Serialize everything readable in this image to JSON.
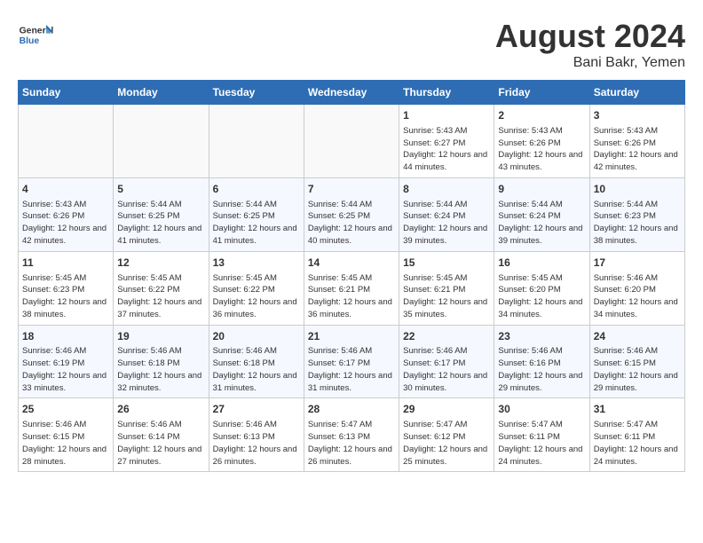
{
  "header": {
    "logo_general": "General",
    "logo_blue": "Blue",
    "title": "August 2024",
    "location": "Bani Bakr, Yemen"
  },
  "weekdays": [
    "Sunday",
    "Monday",
    "Tuesday",
    "Wednesday",
    "Thursday",
    "Friday",
    "Saturday"
  ],
  "weeks": [
    [
      {
        "day": "",
        "sunrise": "",
        "sunset": "",
        "daylight": ""
      },
      {
        "day": "",
        "sunrise": "",
        "sunset": "",
        "daylight": ""
      },
      {
        "day": "",
        "sunrise": "",
        "sunset": "",
        "daylight": ""
      },
      {
        "day": "",
        "sunrise": "",
        "sunset": "",
        "daylight": ""
      },
      {
        "day": "1",
        "sunrise": "Sunrise: 5:43 AM",
        "sunset": "Sunset: 6:27 PM",
        "daylight": "Daylight: 12 hours and 44 minutes."
      },
      {
        "day": "2",
        "sunrise": "Sunrise: 5:43 AM",
        "sunset": "Sunset: 6:26 PM",
        "daylight": "Daylight: 12 hours and 43 minutes."
      },
      {
        "day": "3",
        "sunrise": "Sunrise: 5:43 AM",
        "sunset": "Sunset: 6:26 PM",
        "daylight": "Daylight: 12 hours and 42 minutes."
      }
    ],
    [
      {
        "day": "4",
        "sunrise": "Sunrise: 5:43 AM",
        "sunset": "Sunset: 6:26 PM",
        "daylight": "Daylight: 12 hours and 42 minutes."
      },
      {
        "day": "5",
        "sunrise": "Sunrise: 5:44 AM",
        "sunset": "Sunset: 6:25 PM",
        "daylight": "Daylight: 12 hours and 41 minutes."
      },
      {
        "day": "6",
        "sunrise": "Sunrise: 5:44 AM",
        "sunset": "Sunset: 6:25 PM",
        "daylight": "Daylight: 12 hours and 41 minutes."
      },
      {
        "day": "7",
        "sunrise": "Sunrise: 5:44 AM",
        "sunset": "Sunset: 6:25 PM",
        "daylight": "Daylight: 12 hours and 40 minutes."
      },
      {
        "day": "8",
        "sunrise": "Sunrise: 5:44 AM",
        "sunset": "Sunset: 6:24 PM",
        "daylight": "Daylight: 12 hours and 39 minutes."
      },
      {
        "day": "9",
        "sunrise": "Sunrise: 5:44 AM",
        "sunset": "Sunset: 6:24 PM",
        "daylight": "Daylight: 12 hours and 39 minutes."
      },
      {
        "day": "10",
        "sunrise": "Sunrise: 5:44 AM",
        "sunset": "Sunset: 6:23 PM",
        "daylight": "Daylight: 12 hours and 38 minutes."
      }
    ],
    [
      {
        "day": "11",
        "sunrise": "Sunrise: 5:45 AM",
        "sunset": "Sunset: 6:23 PM",
        "daylight": "Daylight: 12 hours and 38 minutes."
      },
      {
        "day": "12",
        "sunrise": "Sunrise: 5:45 AM",
        "sunset": "Sunset: 6:22 PM",
        "daylight": "Daylight: 12 hours and 37 minutes."
      },
      {
        "day": "13",
        "sunrise": "Sunrise: 5:45 AM",
        "sunset": "Sunset: 6:22 PM",
        "daylight": "Daylight: 12 hours and 36 minutes."
      },
      {
        "day": "14",
        "sunrise": "Sunrise: 5:45 AM",
        "sunset": "Sunset: 6:21 PM",
        "daylight": "Daylight: 12 hours and 36 minutes."
      },
      {
        "day": "15",
        "sunrise": "Sunrise: 5:45 AM",
        "sunset": "Sunset: 6:21 PM",
        "daylight": "Daylight: 12 hours and 35 minutes."
      },
      {
        "day": "16",
        "sunrise": "Sunrise: 5:45 AM",
        "sunset": "Sunset: 6:20 PM",
        "daylight": "Daylight: 12 hours and 34 minutes."
      },
      {
        "day": "17",
        "sunrise": "Sunrise: 5:46 AM",
        "sunset": "Sunset: 6:20 PM",
        "daylight": "Daylight: 12 hours and 34 minutes."
      }
    ],
    [
      {
        "day": "18",
        "sunrise": "Sunrise: 5:46 AM",
        "sunset": "Sunset: 6:19 PM",
        "daylight": "Daylight: 12 hours and 33 minutes."
      },
      {
        "day": "19",
        "sunrise": "Sunrise: 5:46 AM",
        "sunset": "Sunset: 6:18 PM",
        "daylight": "Daylight: 12 hours and 32 minutes."
      },
      {
        "day": "20",
        "sunrise": "Sunrise: 5:46 AM",
        "sunset": "Sunset: 6:18 PM",
        "daylight": "Daylight: 12 hours and 31 minutes."
      },
      {
        "day": "21",
        "sunrise": "Sunrise: 5:46 AM",
        "sunset": "Sunset: 6:17 PM",
        "daylight": "Daylight: 12 hours and 31 minutes."
      },
      {
        "day": "22",
        "sunrise": "Sunrise: 5:46 AM",
        "sunset": "Sunset: 6:17 PM",
        "daylight": "Daylight: 12 hours and 30 minutes."
      },
      {
        "day": "23",
        "sunrise": "Sunrise: 5:46 AM",
        "sunset": "Sunset: 6:16 PM",
        "daylight": "Daylight: 12 hours and 29 minutes."
      },
      {
        "day": "24",
        "sunrise": "Sunrise: 5:46 AM",
        "sunset": "Sunset: 6:15 PM",
        "daylight": "Daylight: 12 hours and 29 minutes."
      }
    ],
    [
      {
        "day": "25",
        "sunrise": "Sunrise: 5:46 AM",
        "sunset": "Sunset: 6:15 PM",
        "daylight": "Daylight: 12 hours and 28 minutes."
      },
      {
        "day": "26",
        "sunrise": "Sunrise: 5:46 AM",
        "sunset": "Sunset: 6:14 PM",
        "daylight": "Daylight: 12 hours and 27 minutes."
      },
      {
        "day": "27",
        "sunrise": "Sunrise: 5:46 AM",
        "sunset": "Sunset: 6:13 PM",
        "daylight": "Daylight: 12 hours and 26 minutes."
      },
      {
        "day": "28",
        "sunrise": "Sunrise: 5:47 AM",
        "sunset": "Sunset: 6:13 PM",
        "daylight": "Daylight: 12 hours and 26 minutes."
      },
      {
        "day": "29",
        "sunrise": "Sunrise: 5:47 AM",
        "sunset": "Sunset: 6:12 PM",
        "daylight": "Daylight: 12 hours and 25 minutes."
      },
      {
        "day": "30",
        "sunrise": "Sunrise: 5:47 AM",
        "sunset": "Sunset: 6:11 PM",
        "daylight": "Daylight: 12 hours and 24 minutes."
      },
      {
        "day": "31",
        "sunrise": "Sunrise: 5:47 AM",
        "sunset": "Sunset: 6:11 PM",
        "daylight": "Daylight: 12 hours and 24 minutes."
      }
    ]
  ]
}
